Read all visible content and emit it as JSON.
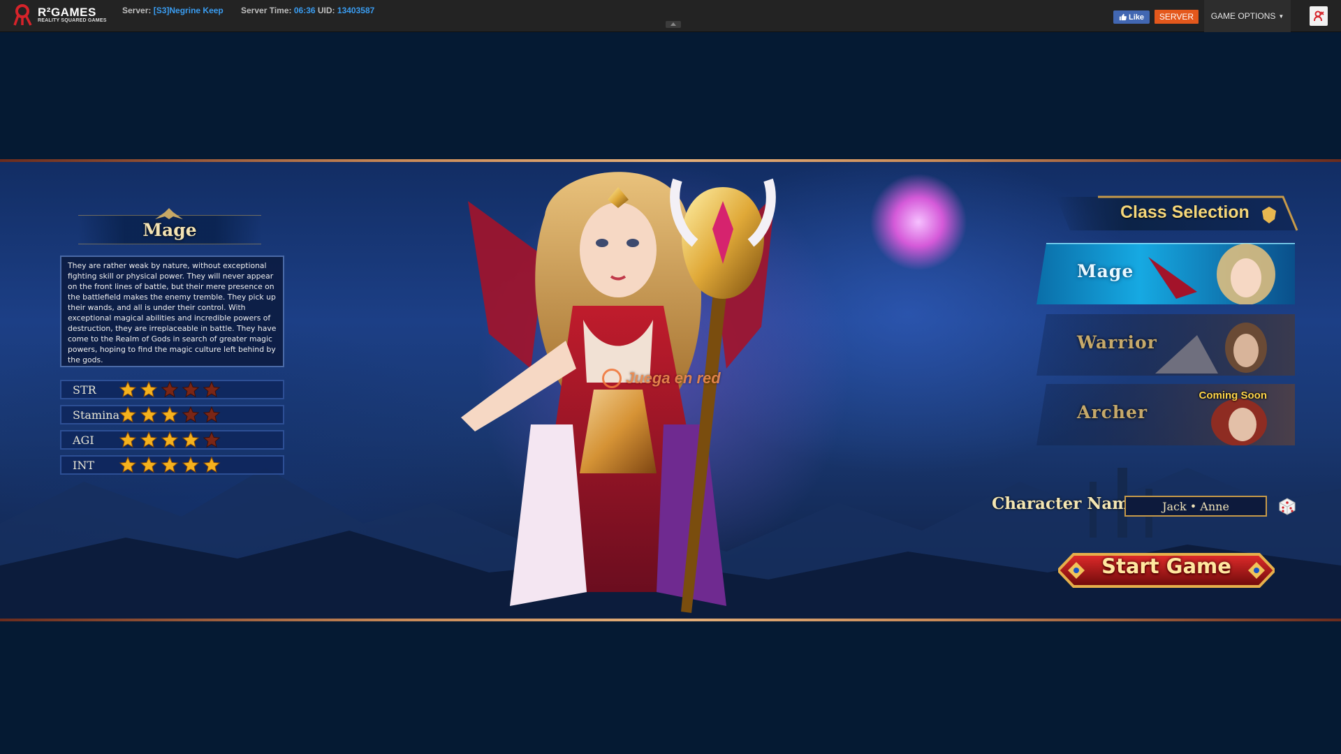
{
  "topbar": {
    "logo": {
      "name": "R²GAMES",
      "tagline": "REALITY SQUARED GAMES"
    },
    "server_label": "Server:",
    "server_value": "[S3]Negrine Keep",
    "time_label": "Server Time:",
    "time_value": "06:36",
    "uid_label": "UID:",
    "uid_value": "13403587",
    "like_label": "Like",
    "server_button": "SERVER",
    "game_options": "GAME OPTIONS",
    "icons": [
      "facebook-like-icon",
      "caret-down-icon",
      "exit-icon"
    ]
  },
  "watermark": "Juega en red",
  "left_panel": {
    "class_name": "Mage",
    "description": "They are rather weak by nature, without exceptional fighting skill or physical power. They will never appear on the front lines of battle, but their mere presence on the battlefield makes the enemy tremble. They pick up their wands, and all is under their control. With exceptional magical abilities and incredible powers of destruction, they are irreplaceable in battle. They have come to the Realm of Gods in search of greater magic powers, hoping to find the magic culture left behind by the gods.",
    "stats": [
      {
        "label": "STR",
        "value": 2,
        "max": 5
      },
      {
        "label": "Stamina",
        "value": 3,
        "max": 5
      },
      {
        "label": "AGI",
        "value": 4,
        "max": 5
      },
      {
        "label": "INT",
        "value": 5,
        "max": 5
      }
    ]
  },
  "right_panel": {
    "title": "Class Selection",
    "classes": [
      {
        "label": "Mage",
        "selected": true,
        "badge": ""
      },
      {
        "label": "Warrior",
        "selected": false,
        "badge": ""
      },
      {
        "label": "Archer",
        "selected": false,
        "badge": "Coming Soon"
      }
    ],
    "char_name_label": "Character Name:",
    "char_name_value": "Jack • Anne",
    "start_button": "Start Game"
  },
  "colors": {
    "page_bg": "#051a33",
    "topbar_bg": "#232323",
    "link_blue": "#3a9cf0",
    "server_orange": "#e4581c",
    "facebook_blue": "#4267b2",
    "star_gold": "#f5b21e",
    "star_dim": "#7a2616"
  }
}
